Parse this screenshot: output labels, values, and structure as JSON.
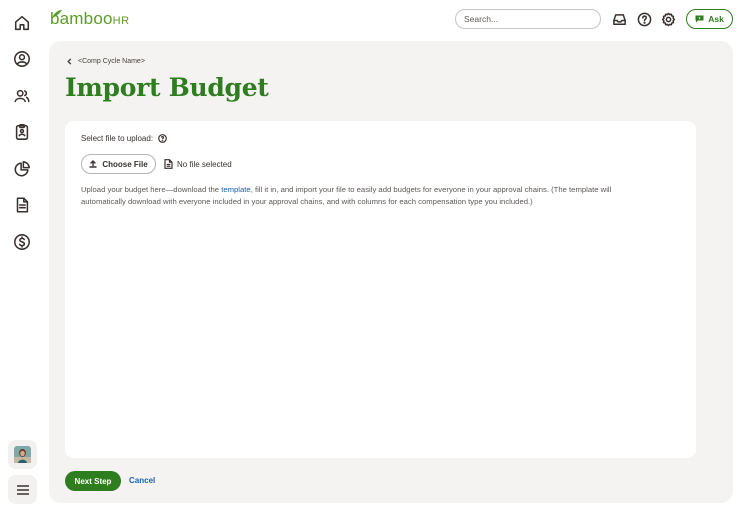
{
  "app": {
    "logo_text": "bamboo",
    "logo_suffix": "HR",
    "brand_color": "#2e7d1f",
    "link_color": "#1f5fb6"
  },
  "nav": {
    "items": [
      {
        "icon": "home-icon"
      },
      {
        "icon": "person-circle-icon"
      },
      {
        "icon": "people-icon"
      },
      {
        "icon": "clipboard-icon"
      },
      {
        "icon": "pie-chart-icon"
      },
      {
        "icon": "document-icon"
      },
      {
        "icon": "dollar-icon"
      }
    ],
    "bottom": [
      {
        "icon": "avatar"
      },
      {
        "icon": "menu-icon"
      }
    ]
  },
  "header": {
    "search_placeholder": "Search...",
    "icons": [
      "inbox-icon",
      "help-icon",
      "gear-icon"
    ],
    "ask_label": "Ask"
  },
  "breadcrumb": {
    "label": "<Comp Cycle Name>"
  },
  "page": {
    "title": "Import Budget"
  },
  "upload": {
    "select_label": "Select file to upload:",
    "choose_file_label": "Choose File",
    "no_file_label": "No file selected",
    "description_before": "Upload your budget here—download the ",
    "template_link": "template",
    "description_after": ", fill it in, and import your file to easily add budgets for everyone in your approval chains. (The template will automatically download with everyone included in your approval chains, and with columns for each compensation type you included.)"
  },
  "footer": {
    "next_label": "Next Step",
    "cancel_label": "Cancel"
  }
}
